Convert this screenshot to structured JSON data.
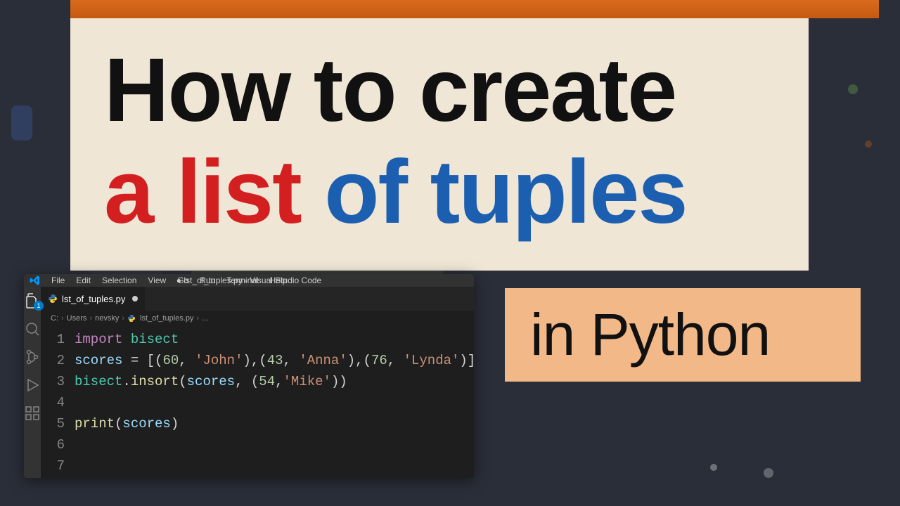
{
  "title": {
    "line1": "How to create",
    "line2_red": "a list",
    "line2_blue": " of tuples"
  },
  "subtitle": "in Python",
  "vscode": {
    "menu": [
      "File",
      "Edit",
      "Selection",
      "View",
      "Go",
      "Run",
      "Terminal",
      "Help"
    ],
    "window_title": "● lst_of_tuples.py - Visual Studio Code",
    "tab": {
      "filename": "lst_of_tuples.py",
      "modified": true
    },
    "breadcrumb": [
      "C:",
      "Users",
      "nevsky",
      "lst_of_tuples.py",
      "..."
    ],
    "activity_badge": "1",
    "code_lines": [
      {
        "n": 1,
        "tokens": [
          [
            "keyword",
            "import"
          ],
          [
            "plain",
            " "
          ],
          [
            "module",
            "bisect"
          ]
        ]
      },
      {
        "n": 2,
        "tokens": [
          [
            "var",
            "scores"
          ],
          [
            "plain",
            " = [("
          ],
          [
            "num",
            "60"
          ],
          [
            "plain",
            ", "
          ],
          [
            "str",
            "'John'"
          ],
          [
            "plain",
            "),("
          ],
          [
            "num",
            "43"
          ],
          [
            "plain",
            ", "
          ],
          [
            "str",
            "'Anna'"
          ],
          [
            "plain",
            "),("
          ],
          [
            "num",
            "76"
          ],
          [
            "plain",
            ", "
          ],
          [
            "str",
            "'Lynda'"
          ],
          [
            "plain",
            ")]"
          ]
        ]
      },
      {
        "n": 3,
        "tokens": [
          [
            "module",
            "bisect"
          ],
          [
            "plain",
            "."
          ],
          [
            "func",
            "insort"
          ],
          [
            "plain",
            "("
          ],
          [
            "var",
            "scores"
          ],
          [
            "plain",
            ", ("
          ],
          [
            "num",
            "54"
          ],
          [
            "plain",
            ","
          ],
          [
            "str",
            "'Mike'"
          ],
          [
            "plain",
            "))"
          ]
        ]
      },
      {
        "n": 4,
        "tokens": []
      },
      {
        "n": 5,
        "tokens": [
          [
            "func",
            "print"
          ],
          [
            "plain",
            "("
          ],
          [
            "var",
            "scores"
          ],
          [
            "plain",
            ")"
          ]
        ]
      },
      {
        "n": 6,
        "tokens": []
      },
      {
        "n": 7,
        "tokens": []
      }
    ]
  }
}
